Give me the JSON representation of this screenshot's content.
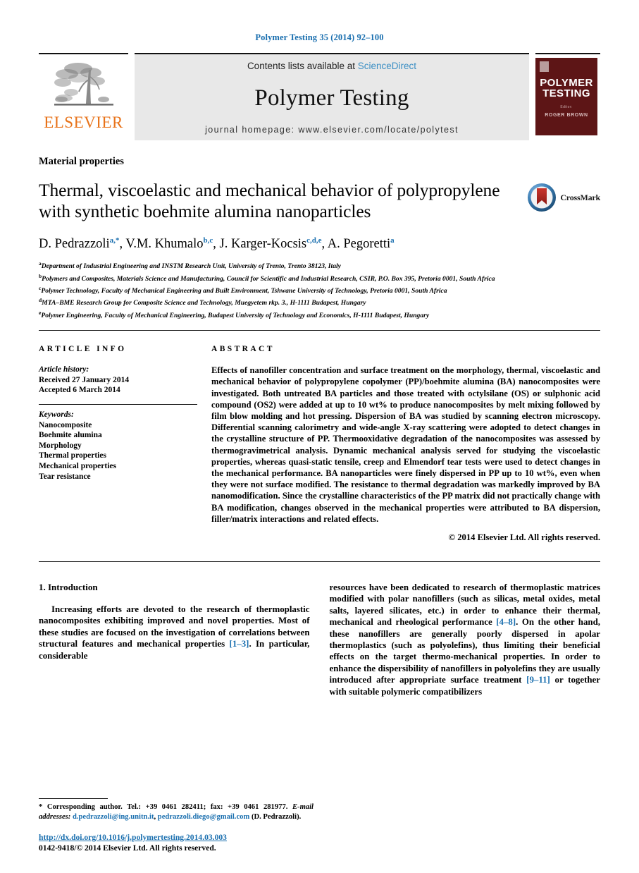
{
  "running_head": "Polymer Testing 35 (2014) 92–100",
  "banner": {
    "contents_prefix": "Contents lists available at ",
    "sciencedirect": "ScienceDirect",
    "journal_name": "Polymer Testing",
    "homepage": "journal homepage: www.elsevier.com/locate/polytest",
    "publisher_wordmark": "ELSEVIER",
    "cover": {
      "title_line1": "POLYMER",
      "title_line2": "TESTING",
      "editor_label": "Editor:",
      "editor_name": "ROGER BROWN"
    }
  },
  "article": {
    "section_label": "Material properties",
    "title": "Thermal, viscoelastic and mechanical behavior of polypropylene with synthetic boehmite alumina nanoparticles",
    "crossmark_label": "CrossMark",
    "authors": [
      {
        "name": "D. Pedrazzoli",
        "sup": "a,*"
      },
      {
        "name": "V.M. Khumalo",
        "sup": "b,c"
      },
      {
        "name": "J. Karger-Kocsis",
        "sup": "c,d,e"
      },
      {
        "name": "A. Pegoretti",
        "sup": "a"
      }
    ],
    "affiliations": [
      {
        "mark": "a",
        "text": "Department of Industrial Engineering and INSTM Research Unit, University of Trento, Trento 38123, Italy"
      },
      {
        "mark": "b",
        "text": "Polymers and Composites, Materials Science and Manufacturing, Council for Scientific and Industrial Research, CSIR, P.O. Box 395, Pretoria 0001, South Africa"
      },
      {
        "mark": "c",
        "text": "Polymer Technology, Faculty of Mechanical Engineering and Built Environment, Tshwane University of Technology, Pretoria 0001, South Africa"
      },
      {
        "mark": "d",
        "text": "MTA–BME Research Group for Composite Science and Technology, Muegyetem rkp. 3., H-1111 Budapest, Hungary"
      },
      {
        "mark": "e",
        "text": "Polymer Engineering, Faculty of Mechanical Engineering, Budapest University of Technology and Economics, H-1111 Budapest, Hungary"
      }
    ]
  },
  "info": {
    "heading": "ARTICLE INFO",
    "history_label": "Article history:",
    "received": "Received 27 January 2014",
    "accepted": "Accepted 6 March 2014",
    "keywords_label": "Keywords:",
    "keywords": [
      "Nanocomposite",
      "Boehmite alumina",
      "Morphology",
      "Thermal properties",
      "Mechanical properties",
      "Tear resistance"
    ]
  },
  "abstract": {
    "heading": "ABSTRACT",
    "text": "Effects of nanofiller concentration and surface treatment on the morphology, thermal, viscoelastic and mechanical behavior of polypropylene copolymer (PP)/boehmite alumina (BA) nanocomposites were investigated. Both untreated BA particles and those treated with octylsilane (OS) or sulphonic acid compound (OS2) were added at up to 10 wt% to produce nanocomposites by melt mixing followed by film blow molding and hot pressing. Dispersion of BA was studied by scanning electron microscopy. Differential scanning calorimetry and wide-angle X-ray scattering were adopted to detect changes in the crystalline structure of PP. Thermooxidative degradation of the nanocomposites was assessed by thermogravimetrical analysis. Dynamic mechanical analysis served for studying the viscoelastic properties, whereas quasi-static tensile, creep and Elmendorf tear tests were used to detect changes in the mechanical performance. BA nanoparticles were finely dispersed in PP up to 10 wt%, even when they were not surface modified. The resistance to thermal degradation was markedly improved by BA nanomodification. Since the crystalline characteristics of the PP matrix did not practically change with BA modification, changes observed in the mechanical properties were attributed to BA dispersion, filler/matrix interactions and related effects.",
    "copyright": "© 2014 Elsevier Ltd. All rights reserved."
  },
  "body": {
    "intro_heading": "1. Introduction",
    "left_paragraph_pre": "Increasing efforts are devoted to the research of thermoplastic nanocomposites exhibiting improved and novel properties. Most of these studies are focused on the investigation of correlations between structural features and mechanical properties ",
    "left_ref": "[1–3]",
    "left_paragraph_post": ". In particular, considerable",
    "right_paragraph_1": "resources have been dedicated to research of thermoplastic matrices modified with polar nanofillers (such as silicas, metal oxides, metal salts, layered silicates, etc.) in order to enhance their thermal, mechanical and rheological performance ",
    "right_ref_1": "[4–8]",
    "right_paragraph_2": ". On the other hand, these nanofillers are generally poorly dispersed in apolar thermoplastics (such as polyolefins), thus limiting their beneficial effects on the target thermo-mechanical properties. In order to enhance the dispersibility of nanofillers in polyolefins they are usually introduced after appropriate surface treatment ",
    "right_ref_2": "[9–11]",
    "right_paragraph_3": " or together with suitable polymeric compatibilizers"
  },
  "footnote": {
    "corresponding": "* Corresponding author. Tel.: +39 0461 282411; fax: +39 0461 281977.",
    "email_label": "E-mail addresses:",
    "email1": "d.pedrazzoli@ing.unitn.it",
    "email2": "pedrazzoli.diego@gmail.com",
    "email_owner": "(D. Pedrazzoli)."
  },
  "doi": "http://dx.doi.org/10.1016/j.polymertesting.2014.03.003",
  "issn_line": "0142-9418/© 2014 Elsevier Ltd. All rights reserved.",
  "colors": {
    "link_blue": "#1a6faf",
    "sciencedirect_blue": "#3c8fc4",
    "elsevier_orange": "#E8731A",
    "cover_maroon": "#5d1516",
    "banner_grey": "#e8e8e8"
  }
}
